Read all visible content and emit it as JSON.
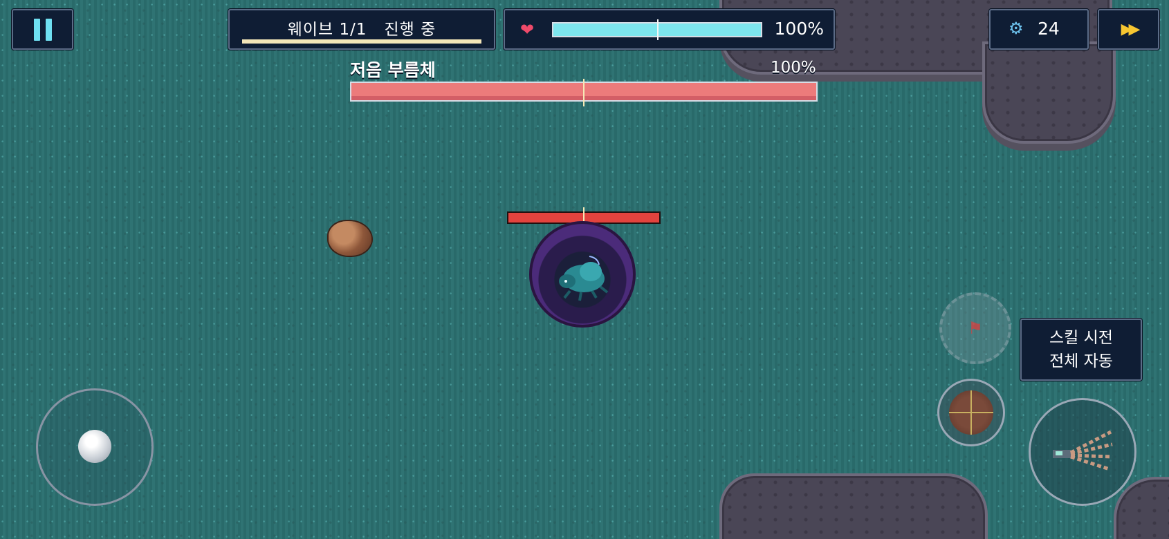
{
  "hud": {
    "wave_text": "웨이브 1/1   진행 중",
    "wave_progress": 1.0,
    "player_hp_pct": "100%",
    "player_hp_fraction": 1.0,
    "gear_count": "24"
  },
  "boss": {
    "name": "저음 부름체",
    "hp_pct": "100%",
    "hp_fraction": 1.0
  },
  "enemy": {
    "hp_fraction": 1.0
  },
  "skills": {
    "auto_cast_line1": "스킬 시전",
    "auto_cast_line2": "전체 자동"
  },
  "icons": {
    "pause": "pause-icon",
    "heart": "heart-icon",
    "gear": "gear-icon",
    "fast_forward": "fast-forward-icon",
    "flag": "flag-icon",
    "crosshair": "crosshair-icon",
    "weapon": "weapon-icon"
  },
  "colors": {
    "panel_bg": "#0f1d34",
    "player_hp": "#7de6ee",
    "boss_hp": "#ec7b7b",
    "enemy_hp": "#e2433e",
    "accent_yellow": "#f7c631"
  }
}
